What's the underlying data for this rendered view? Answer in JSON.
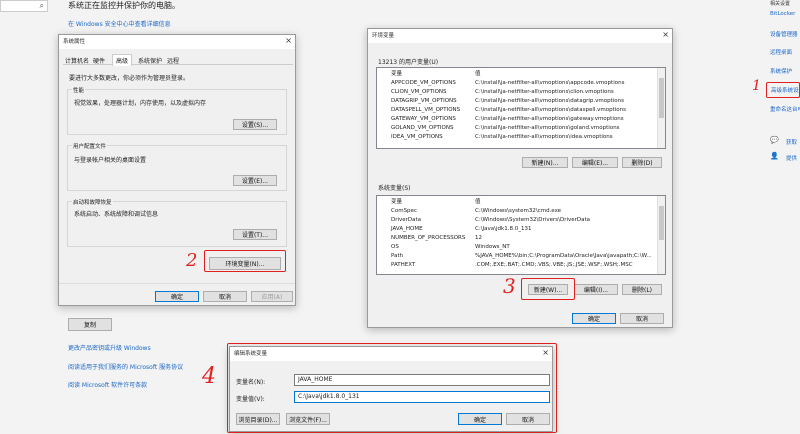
{
  "background": {
    "heading": "系统正在监控并保护你的电脑。",
    "security_link": "在 Windows 安全中心中查看详细信息",
    "copy_button": "复制",
    "links": [
      "更改产品密钥或升级 Windows",
      "阅读适用于我们服务的 Microsoft 服务协议",
      "阅读 Microsoft 软件许可条款"
    ]
  },
  "right_panel": {
    "links": [
      "BitLocker",
      "设备管理器",
      "远程桌面",
      "系统保护",
      "高级系统设置",
      "重命名这台电脑"
    ],
    "help_items": [
      "获取",
      "提供"
    ]
  },
  "system_props": {
    "title": "系统属性",
    "tabs": [
      "计算机名",
      "硬件",
      "高级",
      "系统保护",
      "远程"
    ],
    "admin_note": "要进行大多数更改，你必须作为管理员登录。",
    "performance": {
      "label": "性能",
      "desc": "视觉效果，处理器计划，内存使用，以及虚拟内存",
      "button": "设置(S)..."
    },
    "profiles": {
      "label": "用户配置文件",
      "desc": "与登录帐户相关的桌面设置",
      "button": "设置(E)..."
    },
    "startup": {
      "label": "启动和故障恢复",
      "desc": "系统启动、系统故障和调试信息",
      "button": "设置(T)..."
    },
    "env_button": "环境变量(N)...",
    "ok": "确定",
    "cancel": "取消",
    "apply": "应用(A)"
  },
  "env_vars": {
    "title": "环境变量",
    "user_section": "13213 的用户变量(U)",
    "col_var": "变量",
    "col_val": "值",
    "user_rows": [
      [
        "APPCODE_VM_OPTIONS",
        "C:\\install\\ja-netfilter-all\\vmoptions\\appcode.vmoptions"
      ],
      [
        "CLION_VM_OPTIONS",
        "C:\\install\\ja-netfilter-all\\vmoptions\\clion.vmoptions"
      ],
      [
        "DATAGRIP_VM_OPTIONS",
        "C:\\install\\ja-netfilter-all\\vmoptions\\datagrip.vmoptions"
      ],
      [
        "DATASPELL_VM_OPTIONS",
        "C:\\install\\ja-netfilter-all\\vmoptions\\dataspell.vmoptions"
      ],
      [
        "GATEWAY_VM_OPTIONS",
        "C:\\install\\ja-netfilter-all\\vmoptions\\gateway.vmoptions"
      ],
      [
        "GOLAND_VM_OPTIONS",
        "C:\\install\\ja-netfilter-all\\vmoptions\\goland.vmoptions"
      ],
      [
        "IDEA_VM_OPTIONS",
        "C:\\install\\ja-netfilter-all\\vmoptions\\idea.vmoptions"
      ]
    ],
    "user_new": "新建(N)...",
    "user_edit": "编辑(E)...",
    "user_delete": "删除(D)",
    "sys_section": "系统变量(S)",
    "sys_rows": [
      [
        "ComSpec",
        "C:\\Windows\\system32\\cmd.exe"
      ],
      [
        "DriverData",
        "C:\\Windows\\System32\\Drivers\\DriverData"
      ],
      [
        "JAVA_HOME",
        "C:\\Java\\jdk1.8.0_131"
      ],
      [
        "NUMBER_OF_PROCESSORS",
        "12"
      ],
      [
        "OS",
        "Windows_NT"
      ],
      [
        "Path",
        "%JAVA_HOME%\\bin;C:\\ProgramData\\Oracle\\Java\\javapath;C:\\W..."
      ],
      [
        "PATHEXT",
        ".COM;.EXE;.BAT;.CMD;.VBS;.VBE;.JS;.JSE;.WSF;.WSH;.MSC"
      ]
    ],
    "sys_new": "新建(W)...",
    "sys_edit": "编辑(I)...",
    "sys_delete": "删除(L)",
    "ok": "确定",
    "cancel": "取消"
  },
  "edit_var": {
    "title": "编辑系统变量",
    "name_label": "变量名(N):",
    "name_value": "JAVA_HOME",
    "value_label": "变量值(V):",
    "value_value": "C:\\Java\\jdk1.8.0_131",
    "browse_dir": "浏览目录(D)...",
    "browse_file": "浏览文件(F)...",
    "ok": "确定",
    "cancel": "取消"
  },
  "annotations": [
    "1",
    "2",
    "3",
    "4"
  ],
  "colors": {
    "annotation": "#e02020",
    "link": "#1b67c8",
    "accent": "#0078d7"
  }
}
